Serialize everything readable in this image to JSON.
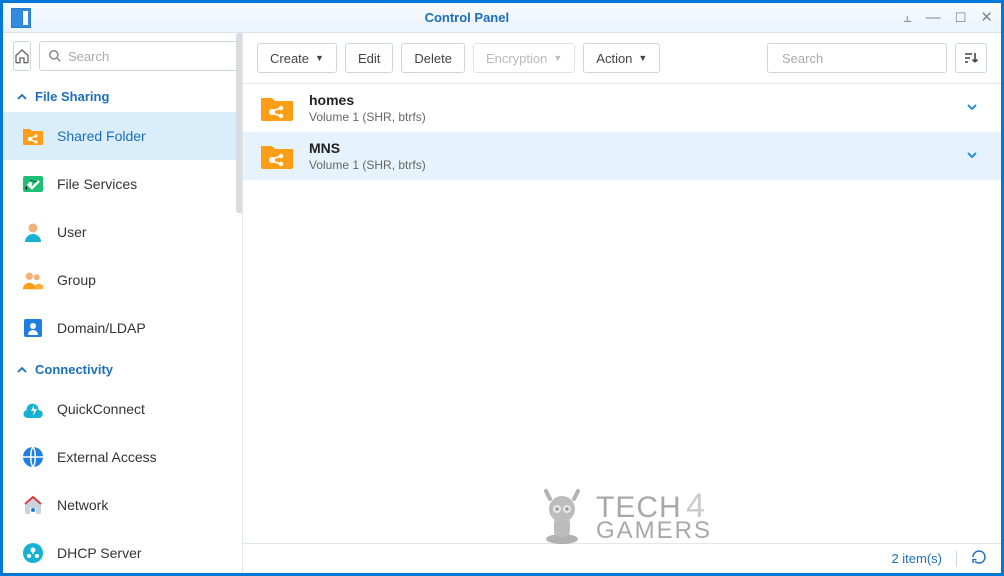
{
  "window": {
    "title": "Control Panel"
  },
  "sidebar": {
    "search_placeholder": "Search",
    "sections": {
      "file_sharing": {
        "label": "File Sharing"
      },
      "connectivity": {
        "label": "Connectivity"
      }
    },
    "items": {
      "shared_folder": "Shared Folder",
      "file_services": "File Services",
      "user": "User",
      "group": "Group",
      "domain_ldap": "Domain/LDAP",
      "quickconnect": "QuickConnect",
      "external_access": "External Access",
      "network": "Network",
      "dhcp_server": "DHCP Server"
    }
  },
  "toolbar": {
    "create": "Create",
    "edit": "Edit",
    "delete": "Delete",
    "encryption": "Encryption",
    "action": "Action",
    "search_placeholder": "Search"
  },
  "folders": [
    {
      "name": "homes",
      "sub": "Volume 1 (SHR, btrfs)"
    },
    {
      "name": "MNS",
      "sub": "Volume 1 (SHR, btrfs)"
    }
  ],
  "status": {
    "count_text": "2 item(s)"
  },
  "watermark": {
    "text_a": "TECH",
    "text_b": "GAMERS",
    "four": "4"
  }
}
